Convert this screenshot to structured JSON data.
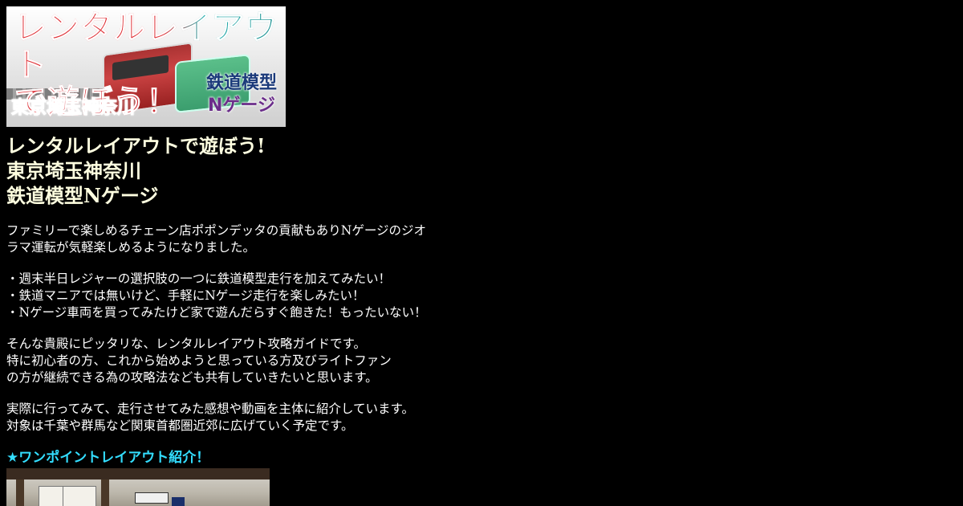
{
  "banner": {
    "title_line1": "レンタルレイアウト",
    "title_line2": "で遊ぼう！",
    "region": "東京埼玉神奈川",
    "badge_line1": "鉄道模型",
    "badge_line2": "Nゲージ"
  },
  "headline": {
    "line1": "レンタルレイアウトで遊ぼう!",
    "line2": "東京埼玉神奈川",
    "line3": "鉄道模型Nゲージ"
  },
  "intro": {
    "line1": "ファミリーで楽しめるチェーン店ポポンデッタの貢献もありNゲージのジオ",
    "line2": "ラマ運転が気軽楽しめるようになりました。"
  },
  "bullets": [
    "・週末半日レジャーの選択肢の一つに鉄道模型走行を加えてみたい！",
    "・鉄道マニアでは無いけど、手軽にNゲージ走行を楽しみたい！",
    "・Nゲージ車両を買ってみたけど家で遊んだらすぐ飽きた！もったいない！"
  ],
  "guide": {
    "line1": "そんな貴殿にピッタリな、レンタルレイアウト攻略ガイドです。",
    "line2": "特に初心者の方、これから始めようと思っている方及びライトファン",
    "line3": "の方が継続できる為の攻略法なども共有していきたいと思います。"
  },
  "content": {
    "line1": "実際に行ってみて、走行させてみた感想や動画を主体に紹介しています。",
    "line2": "対象は千葉や群馬など関東首都圏近郊に広げていく予定です。"
  },
  "section": {
    "title": "★ワンポイントレイアウト紹介！"
  },
  "colors": {
    "background": "#000000",
    "text": "#ffffff",
    "headline": "#ffffe0",
    "accent": "#33ddff"
  }
}
